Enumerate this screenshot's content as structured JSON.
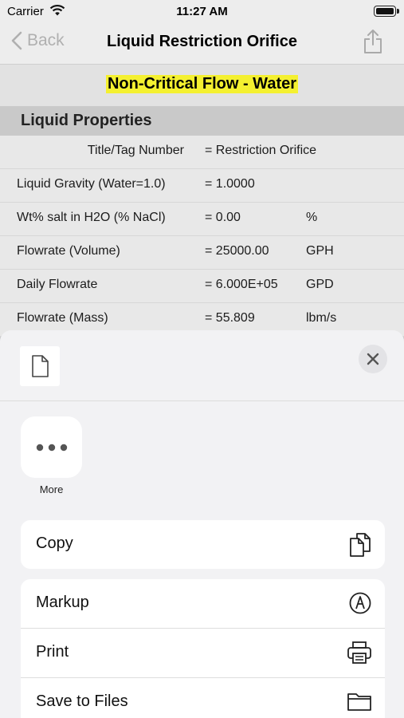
{
  "status_bar": {
    "carrier": "Carrier",
    "time": "11:27 AM"
  },
  "nav": {
    "back_label": "Back",
    "title": "Liquid Restriction Orifice",
    "share_icon": "share-icon"
  },
  "banner": {
    "text": "Non-Critical Flow - Water",
    "highlight_color": "#f4f030"
  },
  "section": {
    "title": "Liquid Properties"
  },
  "properties": [
    {
      "label": "Title/Tag Number",
      "value": "= Restriction Orifice",
      "unit": ""
    },
    {
      "label": "Liquid Gravity (Water=1.0)",
      "value": "= 1.0000",
      "unit": ""
    },
    {
      "label": "Wt% salt in H2O (% NaCl)",
      "value": "= 0.00",
      "unit": "%"
    },
    {
      "label": "Flowrate (Volume)",
      "value": "= 25000.00",
      "unit": "GPH"
    },
    {
      "label": "Daily Flowrate",
      "value": "= 6.000E+05",
      "unit": "GPD"
    },
    {
      "label": "Flowrate (Mass)",
      "value": "= 55.809",
      "unit": "lbm/s"
    }
  ],
  "share_sheet": {
    "more_label": "More",
    "actions_group1": [
      {
        "label": "Copy",
        "icon": "copy-icon"
      }
    ],
    "actions_group2": [
      {
        "label": "Markup",
        "icon": "markup-icon"
      },
      {
        "label": "Print",
        "icon": "print-icon"
      },
      {
        "label": "Save to Files",
        "icon": "folder-icon"
      }
    ]
  }
}
